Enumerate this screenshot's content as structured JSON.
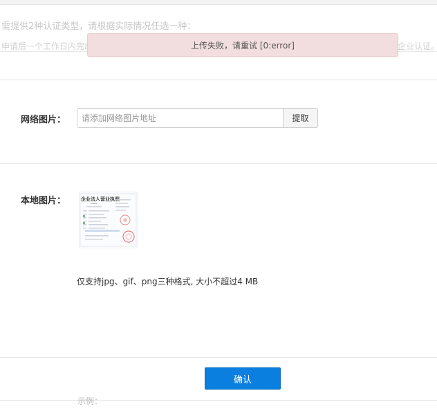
{
  "background": {
    "line1": "需提供2种认证类型，请根据实际情况任选一种：",
    "line2": "申请后一个工作日内完成",
    "line2_right": "企业认证。",
    "bottom_text": "示例："
  },
  "toast": {
    "message": "上传失败，请重试 [0:error]"
  },
  "network_image": {
    "label": "网络图片：",
    "placeholder": "请添加网络图片地址",
    "fetch_label": "提取"
  },
  "local_image": {
    "label": "本地图片：",
    "thumbnail_title": "企业法人营业执照",
    "hint": "仅支持jpg、gif、png三种格式, 大小不超过4 MB"
  },
  "footer": {
    "confirm_label": "确认"
  },
  "colors": {
    "primary_button": "#0b7fe0",
    "toast_bg": "#f2dede",
    "toast_border": "#ebcccc"
  }
}
